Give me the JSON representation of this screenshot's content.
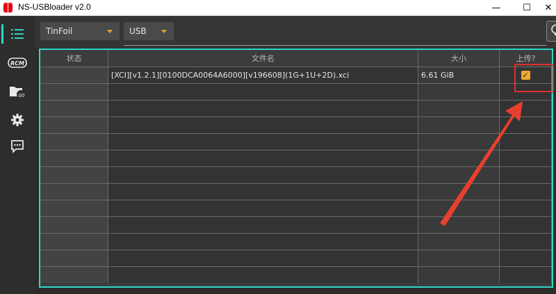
{
  "window": {
    "title": "NS-USBloader v2.0",
    "minimize_glyph": "—",
    "maximize_glyph": "☐",
    "close_glyph": "✕"
  },
  "sidebar": {
    "items": [
      {
        "name": "list-icon",
        "active": true
      },
      {
        "name": "rcm-icon",
        "label": "RCM"
      },
      {
        "name": "folder-transfer-icon",
        "label": "00"
      },
      {
        "name": "gear-icon"
      },
      {
        "name": "chat-icon"
      }
    ]
  },
  "toolbar": {
    "protocol": "TinFoil",
    "mode": "USB"
  },
  "table": {
    "columns": [
      "状态",
      "文件名",
      "大小",
      "上传?"
    ],
    "rows": [
      {
        "status": "",
        "filename": "[XCI][v1.2.1][0100DCA0064A6000][v196608](1G+1U+2D).xci",
        "size": "6.61 GiB",
        "upload": true
      }
    ]
  },
  "colors": {
    "accent": "#2fd8c7",
    "checkbox": "#f0a830",
    "highlight": "#e02e2e"
  }
}
